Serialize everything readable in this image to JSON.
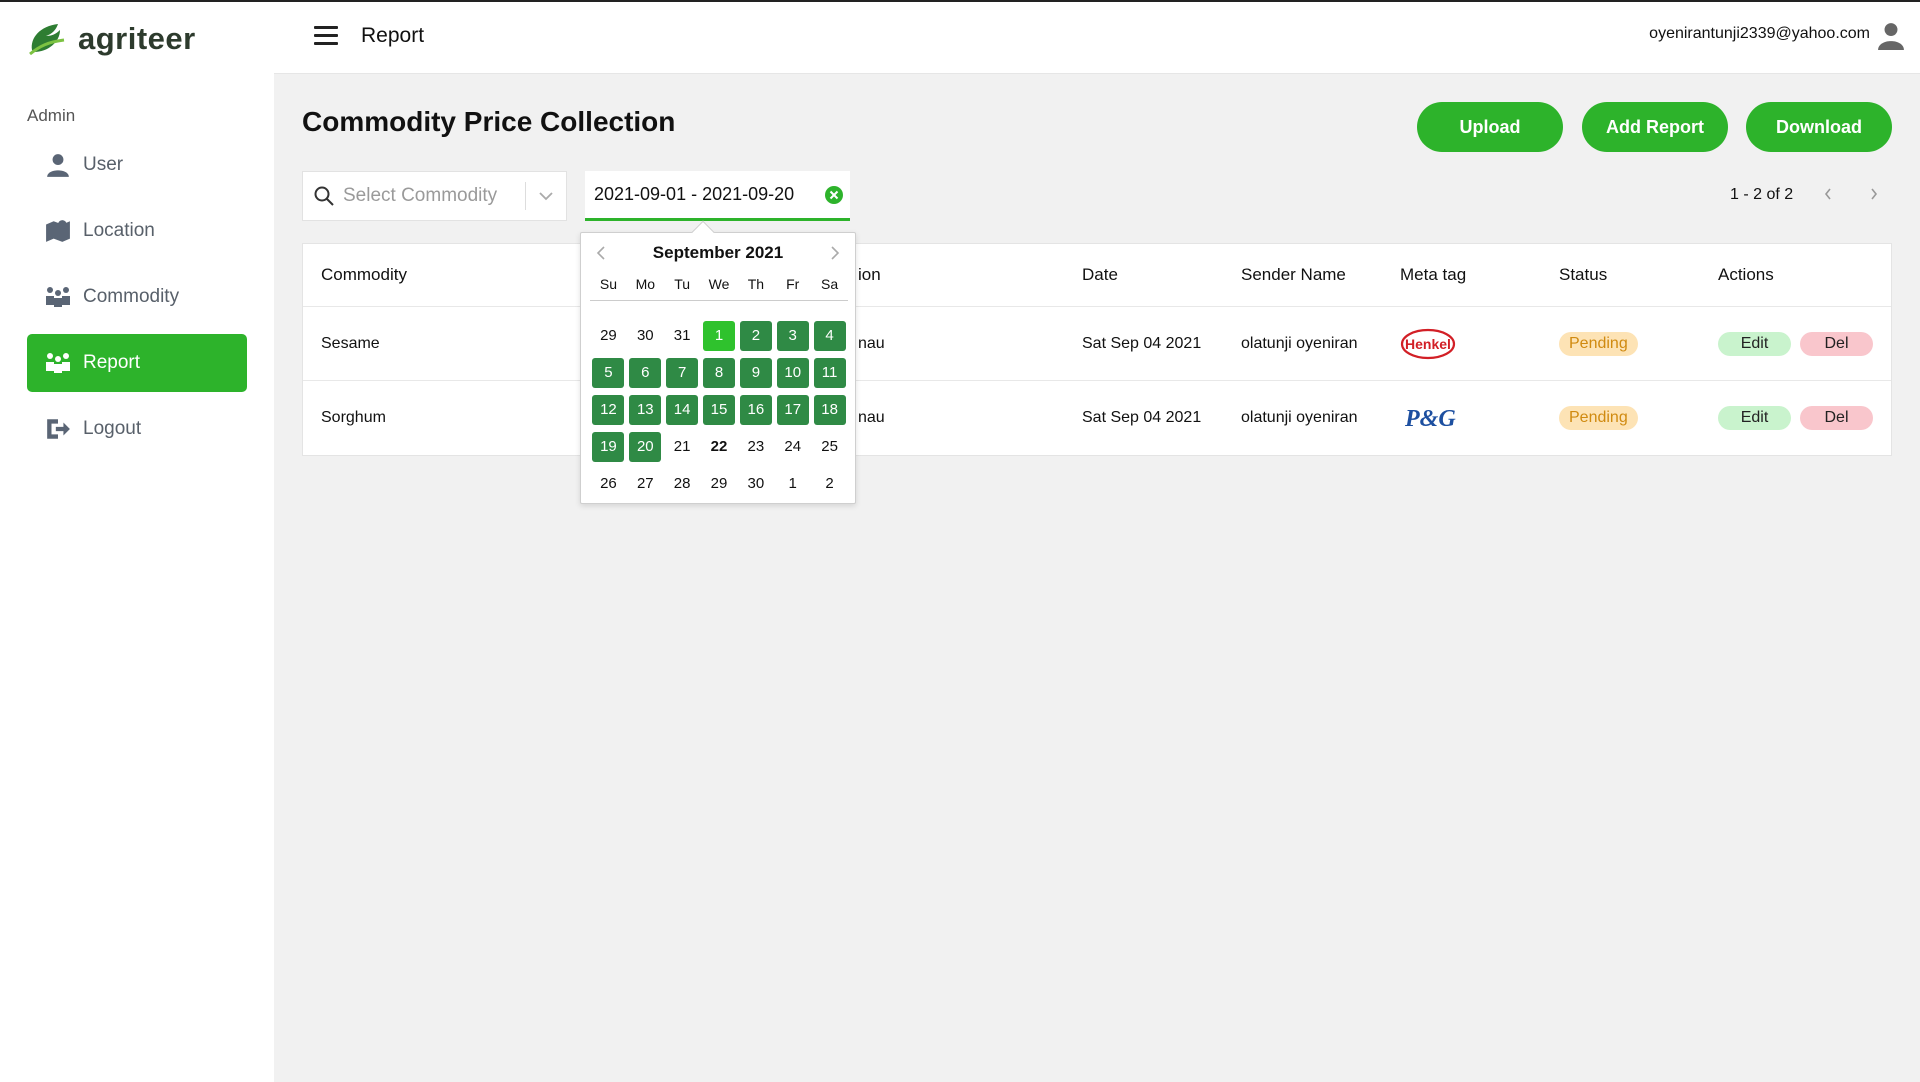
{
  "app": {
    "brand": "agriteer",
    "section_label": "Admin",
    "nav": [
      {
        "label": "User",
        "icon": "user-icon",
        "active": false
      },
      {
        "label": "Location",
        "icon": "map-icon",
        "active": false
      },
      {
        "label": "Commodity",
        "icon": "people-icon",
        "active": false
      },
      {
        "label": "Report",
        "icon": "people-icon",
        "active": true
      },
      {
        "label": "Logout",
        "icon": "logout-icon",
        "active": false
      }
    ],
    "accent_color": "#2db32b"
  },
  "header": {
    "title": "Report",
    "user_email": "oyenirantunji2339@yahoo.com"
  },
  "main": {
    "title": "Commodity Price Collection",
    "buttons": {
      "upload": "Upload",
      "add_report": "Add Report",
      "download": "Download"
    },
    "commodity_select": {
      "placeholder": "Select Commodity"
    },
    "date_range": {
      "value": "2021-09-01 - 2021-09-20"
    },
    "pagination": {
      "text": "1 - 2 of 2"
    }
  },
  "table": {
    "headers": {
      "commodity": "Commodity",
      "location": "ion",
      "date": "Date",
      "sender": "Sender Name",
      "meta": "Meta tag",
      "status": "Status",
      "actions": "Actions"
    },
    "rows": [
      {
        "commodity": "Sesame",
        "location": "nau",
        "date": "Sat Sep 04 2021",
        "sender": "olatunji oyeniran",
        "meta_logo": "Henkel",
        "status": "Pending",
        "edit": "Edit",
        "del": "Del"
      },
      {
        "commodity": "Sorghum",
        "location": "nau",
        "date": "Sat Sep 04 2021",
        "sender": "olatunji oyeniran",
        "meta_logo": "P&G",
        "status": "Pending",
        "edit": "Edit",
        "del": "Del"
      }
    ]
  },
  "calendar": {
    "title": "September 2021",
    "weekdays": [
      "Su",
      "Mo",
      "Tu",
      "We",
      "Th",
      "Fr",
      "Sa"
    ],
    "weeks": [
      [
        {
          "d": "29",
          "s": ""
        },
        {
          "d": "30",
          "s": ""
        },
        {
          "d": "31",
          "s": ""
        },
        {
          "d": "1",
          "s": "start"
        },
        {
          "d": "2",
          "s": "sel"
        },
        {
          "d": "3",
          "s": "sel"
        },
        {
          "d": "4",
          "s": "sel"
        }
      ],
      [
        {
          "d": "5",
          "s": "sel"
        },
        {
          "d": "6",
          "s": "sel"
        },
        {
          "d": "7",
          "s": "sel"
        },
        {
          "d": "8",
          "s": "sel"
        },
        {
          "d": "9",
          "s": "sel"
        },
        {
          "d": "10",
          "s": "sel"
        },
        {
          "d": "11",
          "s": "sel"
        }
      ],
      [
        {
          "d": "12",
          "s": "sel"
        },
        {
          "d": "13",
          "s": "sel"
        },
        {
          "d": "14",
          "s": "sel"
        },
        {
          "d": "15",
          "s": "sel"
        },
        {
          "d": "16",
          "s": "sel"
        },
        {
          "d": "17",
          "s": "sel"
        },
        {
          "d": "18",
          "s": "sel"
        }
      ],
      [
        {
          "d": "19",
          "s": "sel"
        },
        {
          "d": "20",
          "s": "sel"
        },
        {
          "d": "21",
          "s": ""
        },
        {
          "d": "22",
          "s": "today"
        },
        {
          "d": "23",
          "s": ""
        },
        {
          "d": "24",
          "s": ""
        },
        {
          "d": "25",
          "s": ""
        }
      ],
      [
        {
          "d": "26",
          "s": ""
        },
        {
          "d": "27",
          "s": ""
        },
        {
          "d": "28",
          "s": ""
        },
        {
          "d": "29",
          "s": ""
        },
        {
          "d": "30",
          "s": ""
        },
        {
          "d": "1",
          "s": ""
        },
        {
          "d": "2",
          "s": ""
        }
      ]
    ]
  }
}
